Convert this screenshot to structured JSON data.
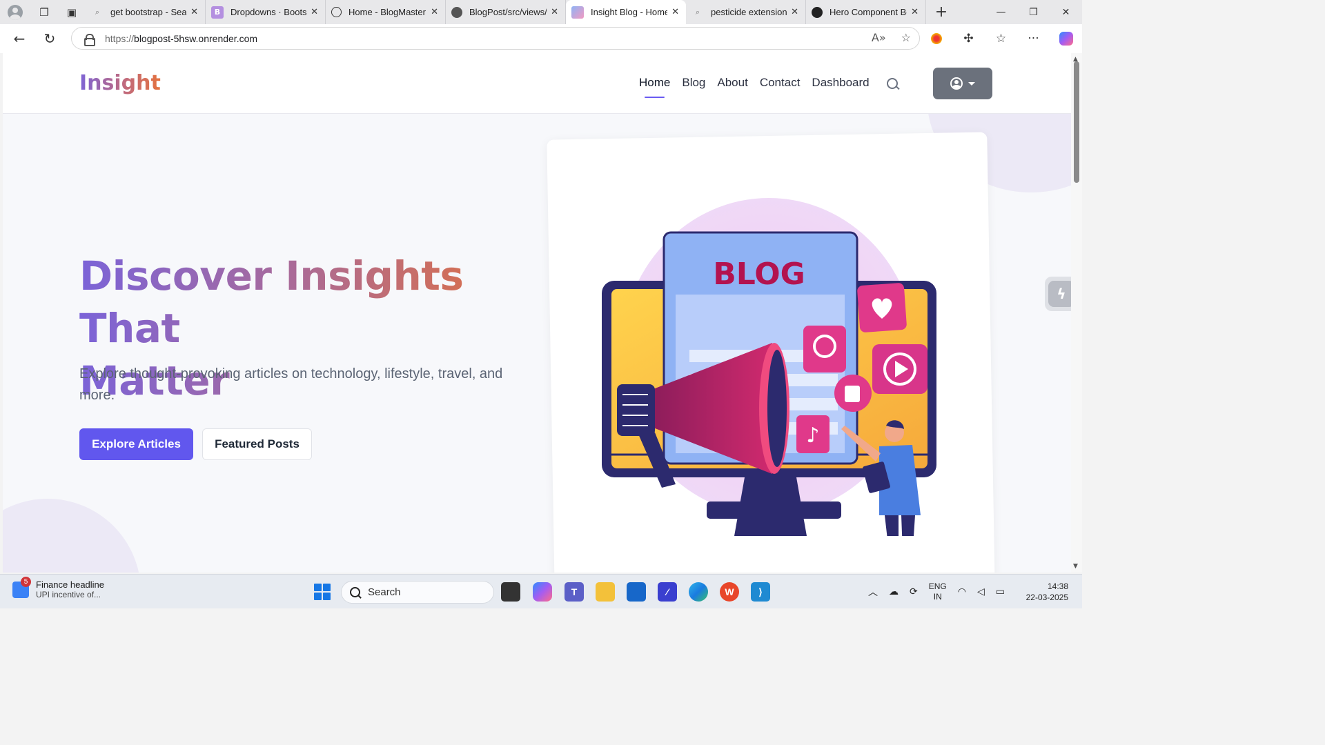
{
  "browser": {
    "tabs": [
      {
        "title": "get bootstrap - Search",
        "icon": "search-icon",
        "active": false
      },
      {
        "title": "Dropdowns · Bootstrap",
        "icon": "bootstrap-icon",
        "active": false
      },
      {
        "title": "Home - BlogMaster",
        "icon": "globe-icon",
        "active": false
      },
      {
        "title": "BlogPost/src/views/r",
        "icon": "github-icon",
        "active": false
      },
      {
        "title": "Insight Blog - Home",
        "icon": "insight-favicon-icon",
        "active": true
      },
      {
        "title": "pesticide extension",
        "icon": "search-icon",
        "active": false
      },
      {
        "title": "Hero Component Bo",
        "icon": "openai-icon",
        "active": false
      }
    ],
    "address": {
      "protocol": "https://",
      "host": "blogpost-5hsw.onrender.com"
    }
  },
  "site": {
    "logo": "Insight",
    "nav": [
      "Home",
      "Blog",
      "About",
      "Contact",
      "Dashboard"
    ],
    "active_nav": "Home"
  },
  "hero": {
    "title_line1": "Discover Insights That",
    "title_line2": "Matter",
    "subtitle": "Explore thought-provoking articles on technology, lifestyle, travel, and more.",
    "primary_button": "Explore Articles",
    "secondary_button": "Featured Posts",
    "illustration_text": "BLOG"
  },
  "taskbar": {
    "news_badge": "5",
    "news_title": "Finance headline",
    "news_sub": "UPI incentive of...",
    "search_placeholder": "Search",
    "language_line1": "ENG",
    "language_line2": "IN",
    "time": "14:38",
    "date": "22-03-2025"
  },
  "colors": {
    "primary": "#6157ee",
    "gradient_start": "#7b63d8",
    "gradient_end": "#e2713e"
  }
}
